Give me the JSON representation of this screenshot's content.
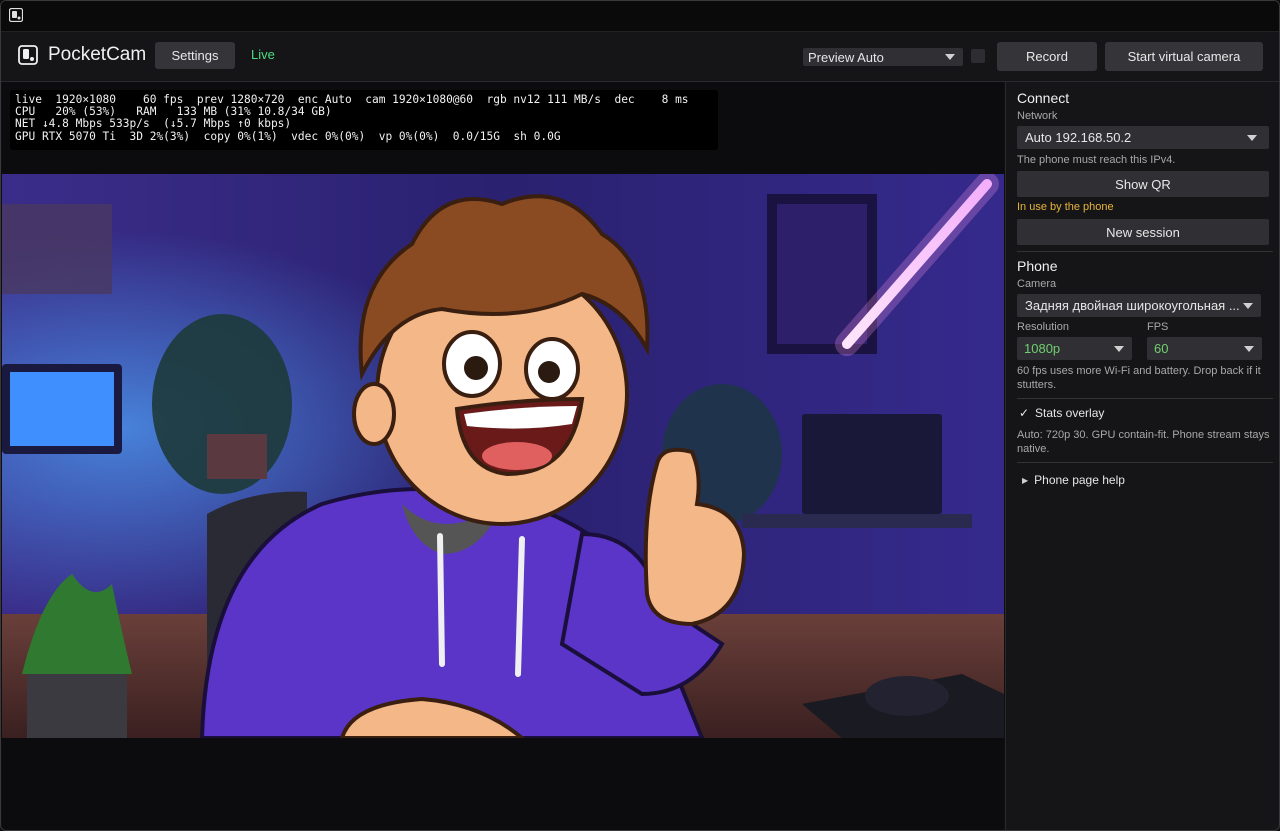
{
  "toolbar": {
    "app_name": "PocketCam",
    "settings_label": "Settings",
    "status": "Live",
    "preview_select": "Preview Auto",
    "record_label": "Record",
    "virtual_cam_label": "Start virtual camera"
  },
  "stats_overlay": {
    "line1": "live  1920×1080    60 fps  prev 1280×720  enc Auto  cam 1920×1080@60  rgb nv12 111 MB/s  dec    8 ms",
    "line2": "CPU   20% (53%)   RAM   133 MB (31% 10.8/34 GB)",
    "line3": "NET ↓4.8 Mbps 533p/s  (↓5.7 Mbps ↑0 kbps)",
    "line4": "GPU RTX 5070 Ti  3D 2%(3%)  copy 0%(1%)  vdec 0%(0%)  vp 0%(0%)  0.0/15G  sh 0.0G"
  },
  "connect": {
    "heading": "Connect",
    "network_label": "Network",
    "network_value": "Auto  192.168.50.2",
    "network_note": "The phone must reach this IPv4.",
    "show_qr_label": "Show QR",
    "in_use_text": "In use by the phone",
    "new_session_label": "New session"
  },
  "phone": {
    "heading": "Phone",
    "camera_label": "Camera",
    "camera_value": "Задняя двойная широкоугольная ...",
    "resolution_label": "Resolution",
    "resolution_value": "1080p",
    "fps_label": "FPS",
    "fps_value": "60",
    "fps_note": "60 fps uses more Wi-Fi and battery. Drop back if it stutters.",
    "stats_overlay_label": "Stats overlay",
    "stats_overlay_checked": true,
    "auto_note": "Auto: 720p 30. GPU contain-fit. Phone stream stays native.",
    "help_label": "Phone page help"
  },
  "colors": {
    "live": "#4ade80",
    "warning": "#e8b43a",
    "hoodie": "#5b35c8",
    "room": "#2a1f6b"
  }
}
